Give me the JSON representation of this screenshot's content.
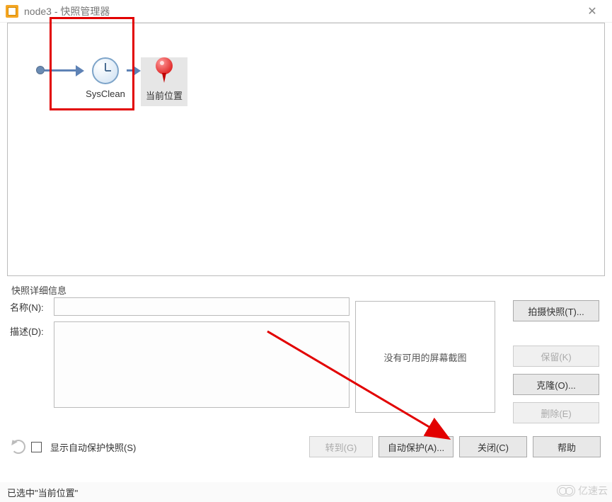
{
  "window": {
    "title": "node3 - 快照管理器"
  },
  "timeline": {
    "snapshot_label": "SysClean",
    "current_pos_label": "当前位置"
  },
  "details": {
    "section_title": "快照详细信息",
    "name_label": "名称(N):",
    "name_value": "",
    "desc_label": "描述(D):",
    "desc_value": "",
    "preview_placeholder": "没有可用的屏幕截图"
  },
  "right_buttons": {
    "take": "拍摄快照(T)...",
    "keep": "保留(K)",
    "clone": "克隆(O)...",
    "delete": "删除(E)"
  },
  "bottom": {
    "show_auto_label": "显示自动保护快照(S)",
    "goto": "转到(G)",
    "auto_protect": "自动保护(A)...",
    "close": "关闭(C)",
    "help": "帮助"
  },
  "status": {
    "text": "已选中\"当前位置\""
  },
  "watermark": "亿速云"
}
